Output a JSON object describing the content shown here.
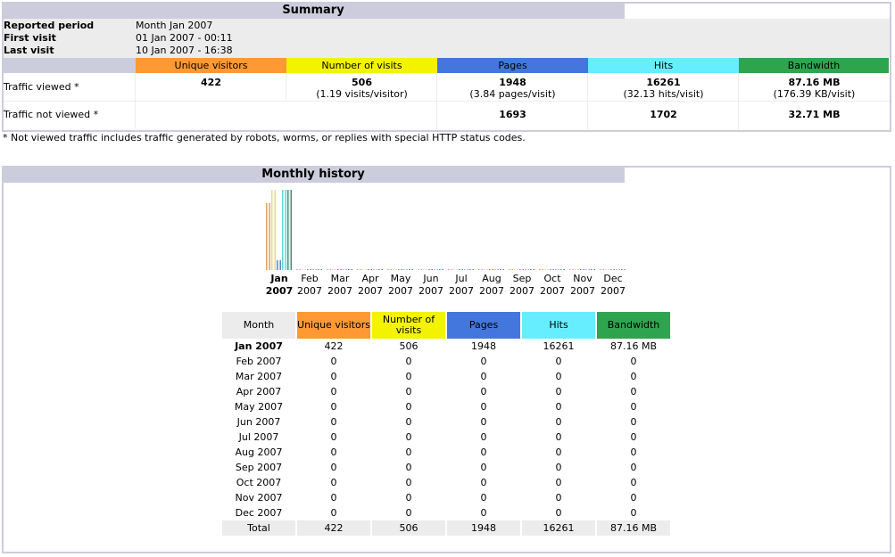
{
  "summary": {
    "title": "Summary",
    "reported_period_label": "Reported period",
    "reported_period": "Month Jan 2007",
    "first_visit_label": "First visit",
    "first_visit": "01 Jan 2007 - 00:11",
    "last_visit_label": "Last visit",
    "last_visit": "10 Jan 2007 - 16:38",
    "columns": [
      "Unique visitors",
      "Number of visits",
      "Pages",
      "Hits",
      "Bandwidth"
    ],
    "viewed_label": "Traffic viewed *",
    "viewed": {
      "visitors": "422",
      "visits": "506",
      "visits_sub": "(1.19 visits/visitor)",
      "pages": "1948",
      "pages_sub": "(3.84 pages/visit)",
      "hits": "16261",
      "hits_sub": "(32.13 hits/visit)",
      "bandwidth": "87.16 MB",
      "bandwidth_sub": "(176.39 KB/visit)"
    },
    "not_viewed_label": "Traffic not viewed *",
    "not_viewed": {
      "pages": "1693",
      "hits": "1702",
      "bandwidth": "32.71 MB"
    },
    "footnote": "* Not viewed traffic includes traffic generated by robots, worms, or replies with special HTTP status codes."
  },
  "colors": {
    "visitors": "#ff9933",
    "visits": "#f3f300",
    "pages": "#4477dd",
    "hits": "#66eeff",
    "bandwidth": "#2ea44f",
    "header": "#ccccdd"
  },
  "history": {
    "title": "Monthly history",
    "month_header": "Month",
    "total_label": "Total",
    "totals": [
      "422",
      "506",
      "1948",
      "16261",
      "87.16 MB"
    ]
  },
  "chart_data": {
    "type": "bar",
    "categories": [
      "Jan 2007",
      "Feb 2007",
      "Mar 2007",
      "Apr 2007",
      "May 2007",
      "Jun 2007",
      "Jul 2007",
      "Aug 2007",
      "Sep 2007",
      "Oct 2007",
      "Nov 2007",
      "Dec 2007"
    ],
    "series": [
      {
        "name": "Unique visitors",
        "values": [
          422,
          0,
          0,
          0,
          0,
          0,
          0,
          0,
          0,
          0,
          0,
          0
        ]
      },
      {
        "name": "Number of visits",
        "values": [
          506,
          0,
          0,
          0,
          0,
          0,
          0,
          0,
          0,
          0,
          0,
          0
        ]
      },
      {
        "name": "Pages",
        "values": [
          1948,
          0,
          0,
          0,
          0,
          0,
          0,
          0,
          0,
          0,
          0,
          0
        ]
      },
      {
        "name": "Hits",
        "values": [
          16261,
          0,
          0,
          0,
          0,
          0,
          0,
          0,
          0,
          0,
          0,
          0
        ]
      },
      {
        "name": "Bandwidth (MB)",
        "values": [
          87.16,
          0,
          0,
          0,
          0,
          0,
          0,
          0,
          0,
          0,
          0,
          0
        ]
      }
    ],
    "bandwidth_labels": [
      "87.16 MB",
      "0",
      "0",
      "0",
      "0",
      "0",
      "0",
      "0",
      "0",
      "0",
      "0",
      "0"
    ]
  }
}
